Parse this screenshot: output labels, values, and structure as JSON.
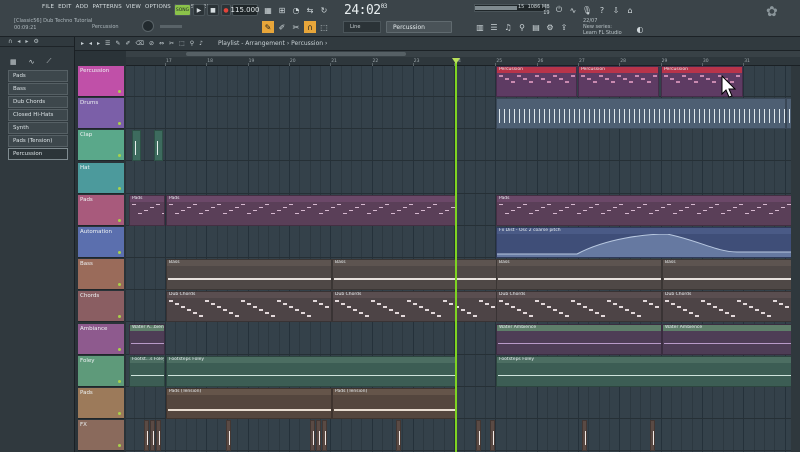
{
  "menu": [
    "FILE",
    "EDIT",
    "ADD",
    "PATTERNS",
    "VIEW",
    "OPTIONS",
    "TOOLS",
    "HELP"
  ],
  "song": {
    "file": "[Classic56] Dub Techno Tutorial",
    "time": "00:09:21",
    "pattern_label": "Percussion"
  },
  "transport": {
    "mode": "SONG",
    "bpm": "115.000",
    "clock_main": "24:02",
    "clock_sub": "03"
  },
  "snap": "Line",
  "pattern": "Percussion",
  "cpu": {
    "mem": "1086 MB",
    "voices": "19",
    "num": "15"
  },
  "news": {
    "date": "22/07",
    "line1": "New series:",
    "line2": "Learn FL Studio"
  },
  "playlist": {
    "title": "Playlist - Arrangement",
    "crumb": "Percussion"
  },
  "browser_items": [
    "Pads",
    "Bass",
    "Dub Chords",
    "Closed Hi-Hats",
    "Synth",
    "Pads (Tension)",
    "Percussion"
  ],
  "bars": [
    "17",
    "18",
    "19",
    "20",
    "21",
    "22",
    "23",
    "24",
    "25",
    "26",
    "27",
    "28",
    "29",
    "30",
    "31"
  ],
  "tracks": [
    {
      "name": "Percussion",
      "color": "#c050a8"
    },
    {
      "name": "Drums",
      "color": "#7b5fa8"
    },
    {
      "name": "Clap",
      "color": "#5aa88a"
    },
    {
      "name": "Hat",
      "color": "#4c9a9c"
    },
    {
      "name": "Pads",
      "color": "#a85a7c"
    },
    {
      "name": "Automation",
      "color": "#5b6fae"
    },
    {
      "name": "Bass",
      "color": "#9a6b5a"
    },
    {
      "name": "Chords",
      "color": "#8a5e62"
    },
    {
      "name": "Ambiance",
      "color": "#8e5a8e"
    },
    {
      "name": "Foley",
      "color": "#5e9a7a"
    },
    {
      "name": "Pads",
      "color": "#9c7a5a"
    },
    {
      "name": "FX",
      "color": "#8a6a5c"
    }
  ],
  "clips": {
    "percussion": "Percussion",
    "pads": "Pads",
    "automation": "Fx Dist - Osc 2 coarse pitch",
    "bass": "Bass",
    "chords": "Dub Chords",
    "ambiance_a": "Water A...bience",
    "ambiance_b": "Water Ambience",
    "foley_a": "Footst...s Foley",
    "foley_b": "Footsteps Foley",
    "pads_tension": "Pads (Tension)"
  },
  "colors": {
    "accent": "#7ed321",
    "percussion_clip": "#b8344a"
  }
}
